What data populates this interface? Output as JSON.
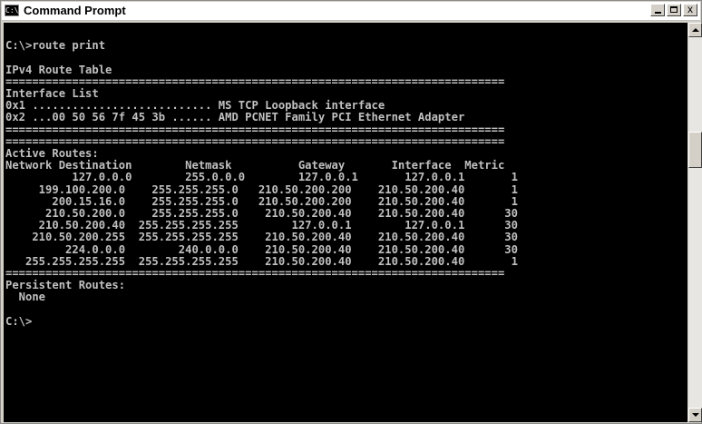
{
  "window": {
    "app_icon_text": "C:\\",
    "title": "Command Prompt",
    "controls": {
      "minimize": "minimize",
      "maximize": "maximize",
      "close": "x"
    }
  },
  "console": {
    "lines": [
      "",
      "C:\\>route print",
      "",
      "IPv4 Route Table",
      "===========================================================================",
      "Interface List",
      "0x1 ........................... MS TCP Loopback interface",
      "0x2 ...00 50 56 7f 45 3b ...... AMD PCNET Family PCI Ethernet Adapter",
      "===========================================================================",
      "===========================================================================",
      "Active Routes:",
      "Network Destination        Netmask          Gateway       Interface  Metric",
      "          127.0.0.0        255.0.0.0        127.0.0.1       127.0.0.1       1",
      "     199.100.200.0    255.255.255.0   210.50.200.200    210.50.200.40       1",
      "       200.15.16.0    255.255.255.0   210.50.200.200    210.50.200.40       1",
      "      210.50.200.0    255.255.255.0    210.50.200.40    210.50.200.40      30",
      "     210.50.200.40  255.255.255.255        127.0.0.1        127.0.0.1      30",
      "    210.50.200.255  255.255.255.255    210.50.200.40    210.50.200.40      30",
      "         224.0.0.0        240.0.0.0    210.50.200.40    210.50.200.40      30",
      "   255.255.255.255  255.255.255.255    210.50.200.40    210.50.200.40       1",
      "===========================================================================",
      "Persistent Routes:",
      "  None",
      "",
      "C:\\>"
    ]
  },
  "colors": {
    "console_bg": "#000000",
    "console_fg": "#c0c0c0",
    "chrome": "#d4d0c8"
  }
}
